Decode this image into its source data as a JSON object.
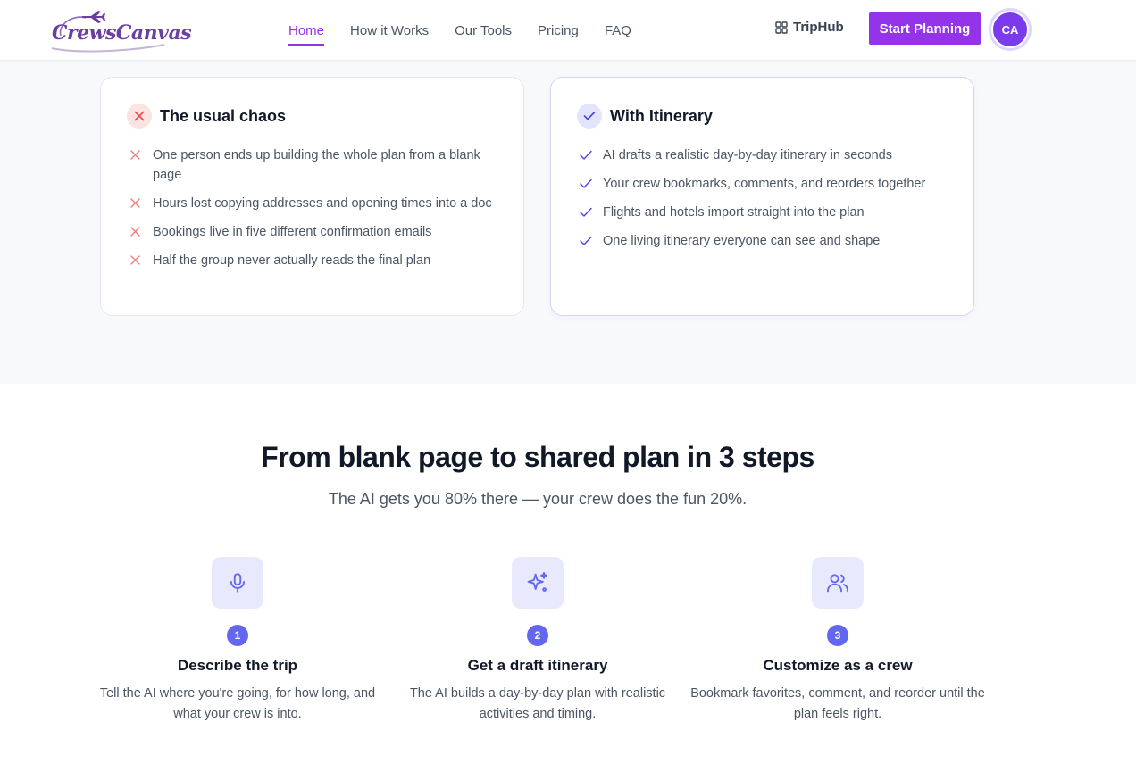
{
  "header": {
    "logo_text": "CrewsCanvas",
    "nav": [
      {
        "label": "Home",
        "active": true
      },
      {
        "label": "How it Works",
        "active": false
      },
      {
        "label": "Our Tools",
        "active": false
      },
      {
        "label": "Pricing",
        "active": false
      },
      {
        "label": "FAQ",
        "active": false
      }
    ],
    "triphub_label": "TripHub",
    "start_button": "Start Planning",
    "avatar_initials": "CA"
  },
  "comparison": {
    "chaos": {
      "title": "The usual chaos",
      "items": [
        "One person ends up building the whole plan from a blank page",
        "Hours lost copying addresses and opening times into a doc",
        "Bookings live in five different confirmation emails",
        "Half the group never actually reads the final plan"
      ]
    },
    "itinerary": {
      "title": "With Itinerary",
      "items": [
        "AI drafts a realistic day-by-day itinerary in seconds",
        "Your crew bookmarks, comments, and reorders together",
        "Flights and hotels import straight into the plan",
        "One living itinerary everyone can see and shape"
      ]
    }
  },
  "steps": {
    "title": "From blank page to shared plan in 3 steps",
    "subtitle": "The AI gets you 80% there — your crew does the fun 20%.",
    "items": [
      {
        "number": "1",
        "icon": "microphone-icon",
        "title": "Describe the trip",
        "desc": "Tell the AI where you're going, for how long, and what your crew is into."
      },
      {
        "number": "2",
        "icon": "sparkles-icon",
        "title": "Get a draft itinerary",
        "desc": "The AI builds a day-by-day plan with realistic activities and timing."
      },
      {
        "number": "3",
        "icon": "users-icon",
        "title": "Customize as a crew",
        "desc": "Bookmark favorites, comment, and reorder until the plan feels right."
      }
    ]
  },
  "colors": {
    "brand_purple": "#9333ea",
    "indigo": "#6366f1",
    "error_red": "#ef4444"
  }
}
